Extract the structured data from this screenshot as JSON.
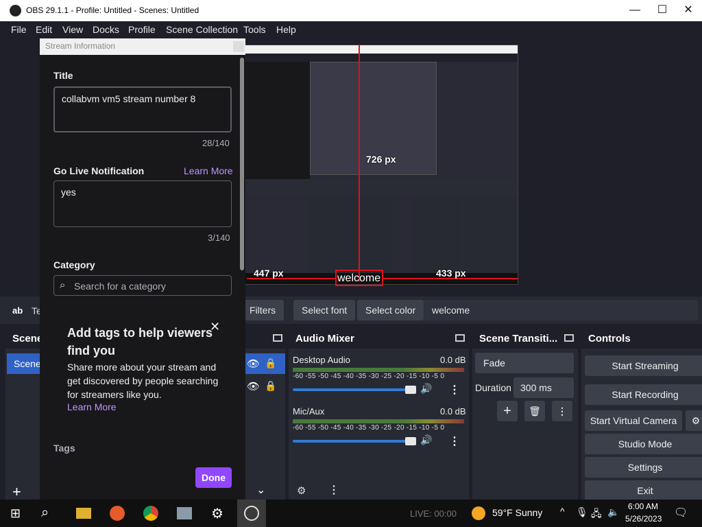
{
  "window": {
    "title": "OBS 29.1.1 - Profile: Untitled - Scenes: Untitled",
    "minimize": "—",
    "maximize": "☐",
    "close": "✕"
  },
  "menu": [
    "File",
    "Edit",
    "View",
    "Docks",
    "Profile",
    "Scene Collection",
    "Tools",
    "Help"
  ],
  "preview": {
    "measure_top": "726 px",
    "measure_left": "447 px",
    "measure_right": "433 px",
    "text_source": "welcome"
  },
  "text_toolbar": {
    "left_icon": "ab",
    "left_text": "Te",
    "filters": "Filters",
    "select_font": "Select font",
    "select_color": "Select color",
    "text_value": "welcome"
  },
  "scenes": {
    "title": "Scene",
    "item": "Scene"
  },
  "audio_mixer": {
    "title": "Audio Mixer",
    "ticks": "-60 -55 -50 -45 -40 -35 -30 -25 -20 -15 -10 -5 0",
    "channels": [
      {
        "name": "Desktop Audio",
        "db": "0.0 dB"
      },
      {
        "name": "Mic/Aux",
        "db": "0.0 dB"
      }
    ]
  },
  "transitions": {
    "title": "Scene Transiti...",
    "select": "Fade",
    "duration_label": "Duration",
    "duration_value": "300 ms"
  },
  "controls": {
    "title": "Controls",
    "start_streaming": "Start Streaming",
    "start_recording": "Start Recording",
    "start_virtual": "Start Virtual Camera",
    "studio_mode": "Studio Mode",
    "settings": "Settings",
    "exit": "Exit"
  },
  "dialog": {
    "header": "Stream Information",
    "title_label": "Title",
    "title_value": "collabvm vm5 stream number 8",
    "title_count": "28/140",
    "notif_label": "Go Live Notification",
    "learn_more": "Learn More",
    "notif_value": "yes",
    "notif_count": "3/140",
    "category_label": "Category",
    "category_placeholder": "Search for a category",
    "tags_heading": "Add tags to help viewers find you",
    "tags_body": "Share more about your stream and get discovered by people searching for streamers like you.",
    "tags_learn_more": "Learn More",
    "tags_label": "Tags",
    "done": "Done"
  },
  "taskbar": {
    "live": "LIVE: 00:00",
    "weather": "59°F  Sunny",
    "time": "6:00 AM",
    "date": "5/26/2023"
  },
  "colors": {
    "accent_purple": "#9147ff",
    "obs_bg": "#1e1f29",
    "dock_bg": "#272a33",
    "selection_blue": "#2f7bd6",
    "guide_red": "#e0121a"
  }
}
